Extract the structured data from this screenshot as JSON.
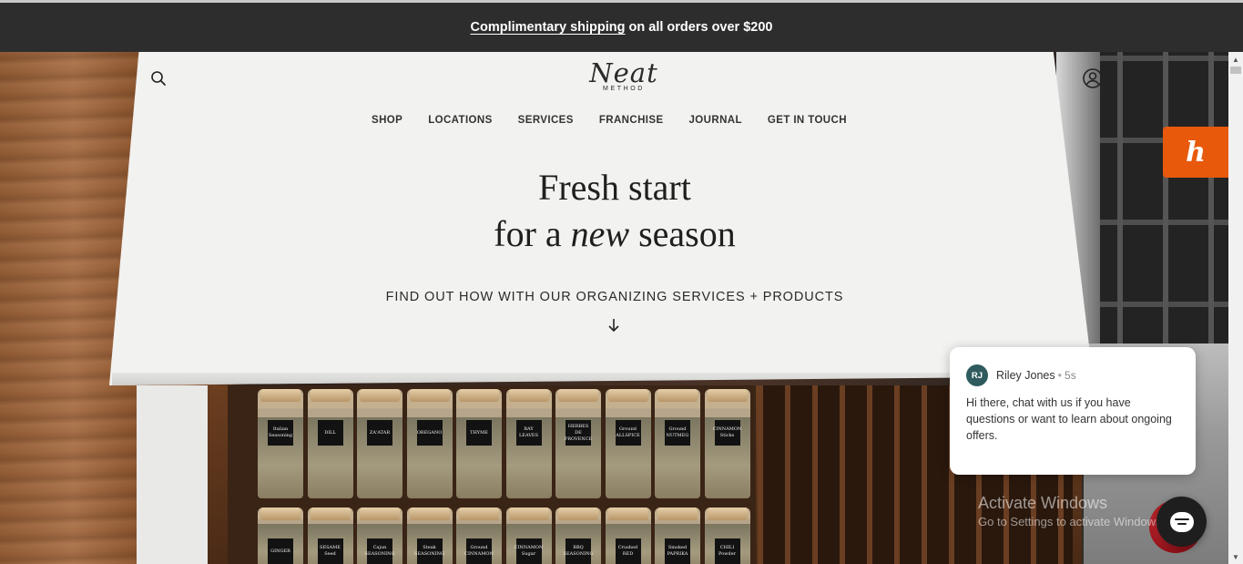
{
  "promo": {
    "link_text": "Complimentary shipping",
    "rest_text": "on all orders over $200"
  },
  "logo": {
    "word": "Neat",
    "sub": "METHOD"
  },
  "nav": {
    "items": [
      "SHOP",
      "LOCATIONS",
      "SERVICES",
      "FRANCHISE",
      "JOURNAL",
      "GET IN TOUCH"
    ]
  },
  "hero": {
    "line1": "Fresh start",
    "line2_pre": "for a",
    "line2_em": "new",
    "line2_post": "season",
    "cta": "FIND OUT HOW WITH OUR ORGANIZING SERVICES + PRODUCTS"
  },
  "jars_top": [
    "Italian Seasoning",
    "DILL",
    "ZA'ATAR",
    "OREGANO",
    "THYME",
    "BAY LEAVES",
    "HERBES DE PROVENCE",
    "Ground ALLSPICE",
    "Ground NUTMEG",
    "CINNAMON Sticks"
  ],
  "jars_bottom": [
    "GINGER",
    "SESAME Seed",
    "Cajun SEASONING",
    "Steak SEASONING",
    "Ground CINNAMON",
    "CINNAMON Sugar",
    "BBQ SEASONING",
    "Crushed RED",
    "Smoked PAPRIKA",
    "CHILI Powder"
  ],
  "honey": {
    "glyph": "h"
  },
  "chat": {
    "initials": "RJ",
    "name": "Riley Jones",
    "time": "5s",
    "message": "Hi there, chat with us if you have questions or want to learn about ongoing offers."
  },
  "watermark": {
    "title": "Activate Windows",
    "sub": "Go to Settings to activate Windows."
  },
  "icons": {
    "search": "search-icon",
    "account": "account-icon",
    "arrow": "arrow-down-icon",
    "chat": "chat-icon"
  },
  "colors": {
    "promo_bg": "#2d2d2d",
    "honey": "#e8590c",
    "avatar": "#2f5b5e",
    "chat_button": "#1e1e1e"
  }
}
